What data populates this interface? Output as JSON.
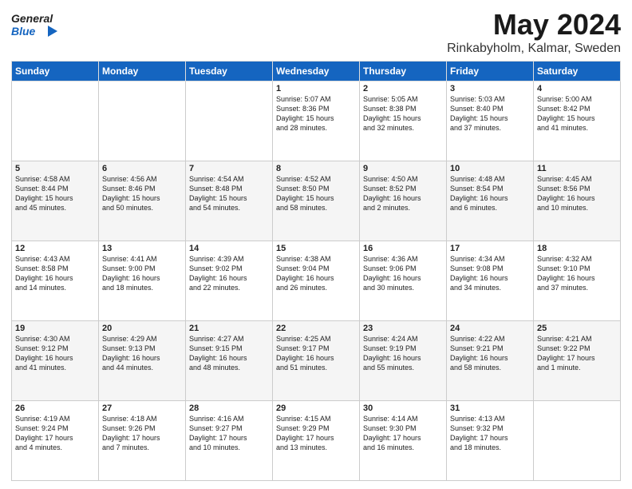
{
  "header": {
    "logo_general": "General",
    "logo_blue": "Blue",
    "title": "May 2024",
    "subtitle": "Rinkabyholm, Kalmar, Sweden"
  },
  "days_of_week": [
    "Sunday",
    "Monday",
    "Tuesday",
    "Wednesday",
    "Thursday",
    "Friday",
    "Saturday"
  ],
  "weeks": [
    [
      {
        "day": "",
        "info": ""
      },
      {
        "day": "",
        "info": ""
      },
      {
        "day": "",
        "info": ""
      },
      {
        "day": "1",
        "info": "Sunrise: 5:07 AM\nSunset: 8:36 PM\nDaylight: 15 hours\nand 28 minutes."
      },
      {
        "day": "2",
        "info": "Sunrise: 5:05 AM\nSunset: 8:38 PM\nDaylight: 15 hours\nand 32 minutes."
      },
      {
        "day": "3",
        "info": "Sunrise: 5:03 AM\nSunset: 8:40 PM\nDaylight: 15 hours\nand 37 minutes."
      },
      {
        "day": "4",
        "info": "Sunrise: 5:00 AM\nSunset: 8:42 PM\nDaylight: 15 hours\nand 41 minutes."
      }
    ],
    [
      {
        "day": "5",
        "info": "Sunrise: 4:58 AM\nSunset: 8:44 PM\nDaylight: 15 hours\nand 45 minutes."
      },
      {
        "day": "6",
        "info": "Sunrise: 4:56 AM\nSunset: 8:46 PM\nDaylight: 15 hours\nand 50 minutes."
      },
      {
        "day": "7",
        "info": "Sunrise: 4:54 AM\nSunset: 8:48 PM\nDaylight: 15 hours\nand 54 minutes."
      },
      {
        "day": "8",
        "info": "Sunrise: 4:52 AM\nSunset: 8:50 PM\nDaylight: 15 hours\nand 58 minutes."
      },
      {
        "day": "9",
        "info": "Sunrise: 4:50 AM\nSunset: 8:52 PM\nDaylight: 16 hours\nand 2 minutes."
      },
      {
        "day": "10",
        "info": "Sunrise: 4:48 AM\nSunset: 8:54 PM\nDaylight: 16 hours\nand 6 minutes."
      },
      {
        "day": "11",
        "info": "Sunrise: 4:45 AM\nSunset: 8:56 PM\nDaylight: 16 hours\nand 10 minutes."
      }
    ],
    [
      {
        "day": "12",
        "info": "Sunrise: 4:43 AM\nSunset: 8:58 PM\nDaylight: 16 hours\nand 14 minutes."
      },
      {
        "day": "13",
        "info": "Sunrise: 4:41 AM\nSunset: 9:00 PM\nDaylight: 16 hours\nand 18 minutes."
      },
      {
        "day": "14",
        "info": "Sunrise: 4:39 AM\nSunset: 9:02 PM\nDaylight: 16 hours\nand 22 minutes."
      },
      {
        "day": "15",
        "info": "Sunrise: 4:38 AM\nSunset: 9:04 PM\nDaylight: 16 hours\nand 26 minutes."
      },
      {
        "day": "16",
        "info": "Sunrise: 4:36 AM\nSunset: 9:06 PM\nDaylight: 16 hours\nand 30 minutes."
      },
      {
        "day": "17",
        "info": "Sunrise: 4:34 AM\nSunset: 9:08 PM\nDaylight: 16 hours\nand 34 minutes."
      },
      {
        "day": "18",
        "info": "Sunrise: 4:32 AM\nSunset: 9:10 PM\nDaylight: 16 hours\nand 37 minutes."
      }
    ],
    [
      {
        "day": "19",
        "info": "Sunrise: 4:30 AM\nSunset: 9:12 PM\nDaylight: 16 hours\nand 41 minutes."
      },
      {
        "day": "20",
        "info": "Sunrise: 4:29 AM\nSunset: 9:13 PM\nDaylight: 16 hours\nand 44 minutes."
      },
      {
        "day": "21",
        "info": "Sunrise: 4:27 AM\nSunset: 9:15 PM\nDaylight: 16 hours\nand 48 minutes."
      },
      {
        "day": "22",
        "info": "Sunrise: 4:25 AM\nSunset: 9:17 PM\nDaylight: 16 hours\nand 51 minutes."
      },
      {
        "day": "23",
        "info": "Sunrise: 4:24 AM\nSunset: 9:19 PM\nDaylight: 16 hours\nand 55 minutes."
      },
      {
        "day": "24",
        "info": "Sunrise: 4:22 AM\nSunset: 9:21 PM\nDaylight: 16 hours\nand 58 minutes."
      },
      {
        "day": "25",
        "info": "Sunrise: 4:21 AM\nSunset: 9:22 PM\nDaylight: 17 hours\nand 1 minute."
      }
    ],
    [
      {
        "day": "26",
        "info": "Sunrise: 4:19 AM\nSunset: 9:24 PM\nDaylight: 17 hours\nand 4 minutes."
      },
      {
        "day": "27",
        "info": "Sunrise: 4:18 AM\nSunset: 9:26 PM\nDaylight: 17 hours\nand 7 minutes."
      },
      {
        "day": "28",
        "info": "Sunrise: 4:16 AM\nSunset: 9:27 PM\nDaylight: 17 hours\nand 10 minutes."
      },
      {
        "day": "29",
        "info": "Sunrise: 4:15 AM\nSunset: 9:29 PM\nDaylight: 17 hours\nand 13 minutes."
      },
      {
        "day": "30",
        "info": "Sunrise: 4:14 AM\nSunset: 9:30 PM\nDaylight: 17 hours\nand 16 minutes."
      },
      {
        "day": "31",
        "info": "Sunrise: 4:13 AM\nSunset: 9:32 PM\nDaylight: 17 hours\nand 18 minutes."
      },
      {
        "day": "",
        "info": ""
      }
    ]
  ]
}
